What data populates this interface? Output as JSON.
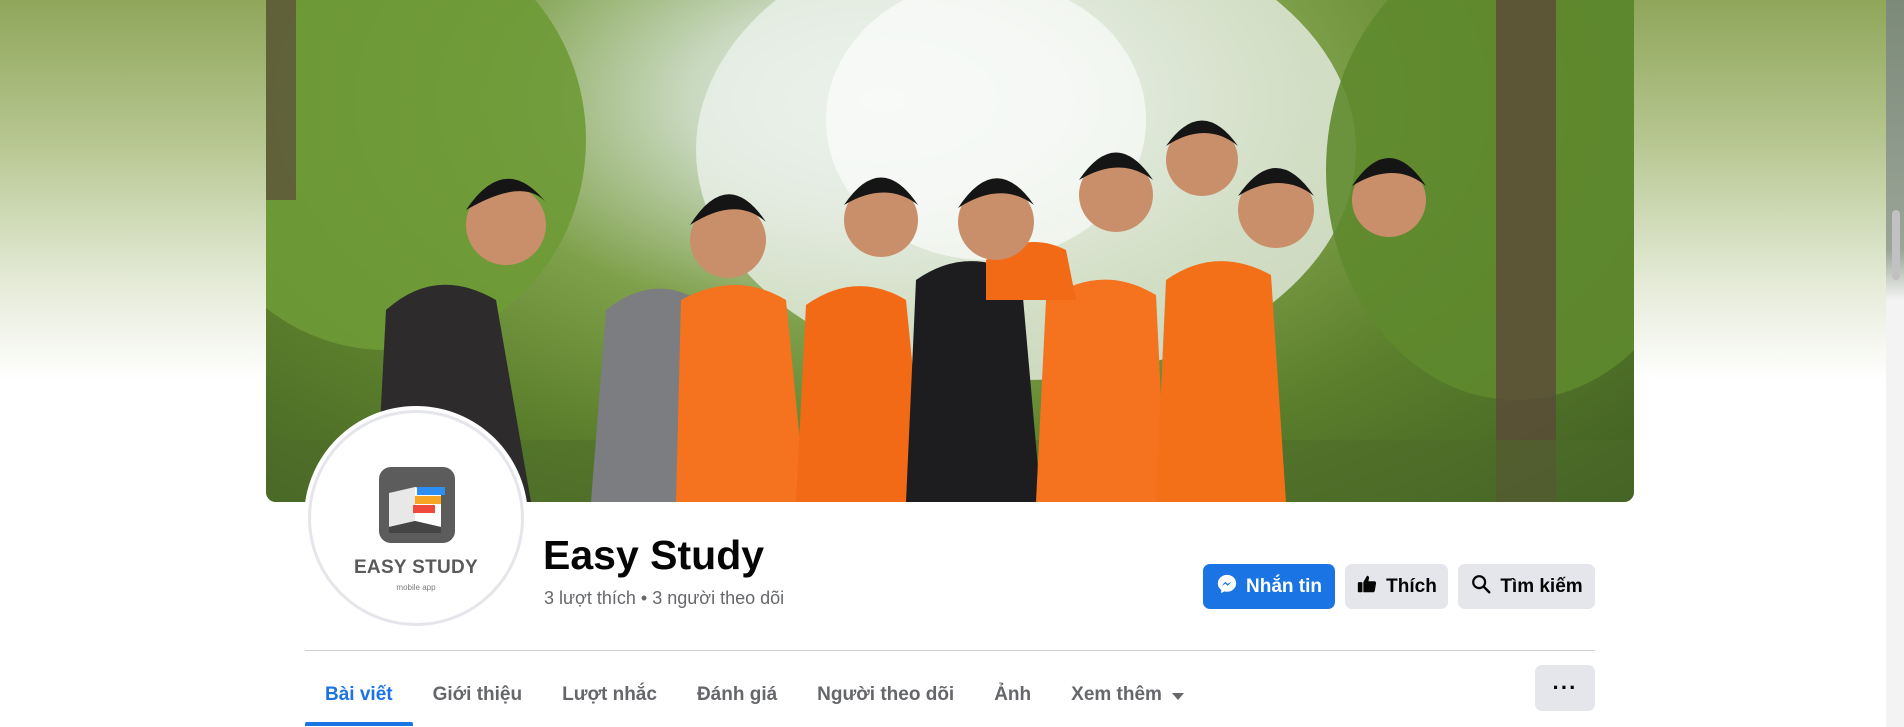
{
  "page": {
    "name": "Easy Study",
    "stats": "3 lượt thích • 3 người theo dõi",
    "logo_title": "EASY STUDY",
    "logo_subtitle": "mobile app"
  },
  "actions": {
    "message_label": "Nhắn tin",
    "like_label": "Thích",
    "search_label": "Tìm kiếm"
  },
  "tabs": [
    {
      "label": "Bài viết",
      "active": true
    },
    {
      "label": "Giới thiệu",
      "active": false
    },
    {
      "label": "Lượt nhắc",
      "active": false
    },
    {
      "label": "Đánh giá",
      "active": false
    },
    {
      "label": "Người theo dõi",
      "active": false
    },
    {
      "label": "Ảnh",
      "active": false
    },
    {
      "label": "Xem thêm",
      "active": false
    }
  ],
  "more_menu_label": "···",
  "colors": {
    "accent": "#1b74e4",
    "button_gray": "#e4e6eb",
    "text_primary": "#050505",
    "text_secondary": "#65676b",
    "shirt_orange": "#f5721e"
  },
  "icons": [
    "messenger-icon",
    "thumbs-up-icon",
    "search-icon",
    "caret-down-icon",
    "more-options-icon"
  ]
}
